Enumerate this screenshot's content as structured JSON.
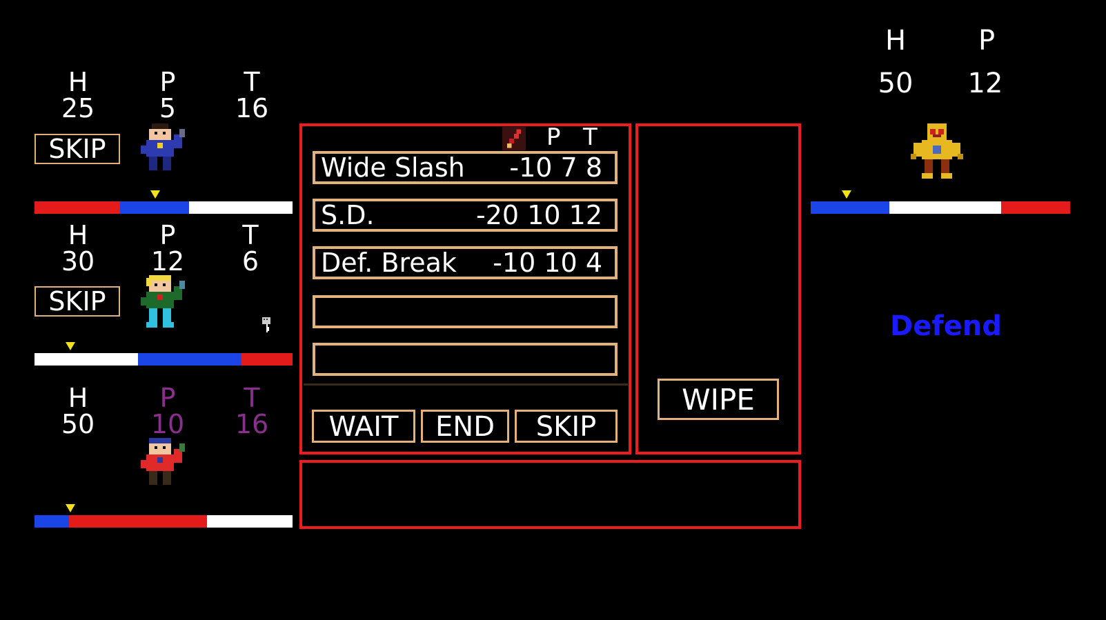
{
  "stat_labels": {
    "h": "H",
    "p": "P",
    "t": "T"
  },
  "party": [
    {
      "hp": "25",
      "pp": "5",
      "tp": "16",
      "skip_label": "SKIP"
    },
    {
      "hp": "30",
      "pp": "12",
      "tp": "6",
      "skip_label": "SKIP"
    },
    {
      "hp": "50",
      "pp": "10",
      "tp": "16",
      "skip_label": ""
    }
  ],
  "skill_panel": {
    "header_p": "P",
    "header_t": "T",
    "skills": [
      {
        "name": "Wide Slash",
        "power": "-10",
        "p": "7",
        "t": "8"
      },
      {
        "name": "S.D.",
        "power": "-20",
        "p": "10",
        "t": "12"
      },
      {
        "name": "Def. Break",
        "power": "-10",
        "p": "10",
        "t": "4"
      },
      {
        "name": "",
        "power": "",
        "p": "",
        "t": ""
      },
      {
        "name": "",
        "power": "",
        "p": "",
        "t": ""
      }
    ],
    "commands": {
      "wait": "WAIT",
      "end": "END",
      "skip": "SKIP"
    }
  },
  "side_panel": {
    "wipe_label": "WIPE"
  },
  "enemy": {
    "hp": "50",
    "pp": "12",
    "intent": "Defend"
  },
  "colors": {
    "panel_border": "#ee1c1c",
    "button_border": "#e2b27a",
    "bar_red": "#e41b1b",
    "bar_blue": "#1b45e6",
    "bar_white": "#ffffff",
    "marker": "#f0e020",
    "defend": "#1a1aff",
    "purple": "#8a2f8e"
  }
}
